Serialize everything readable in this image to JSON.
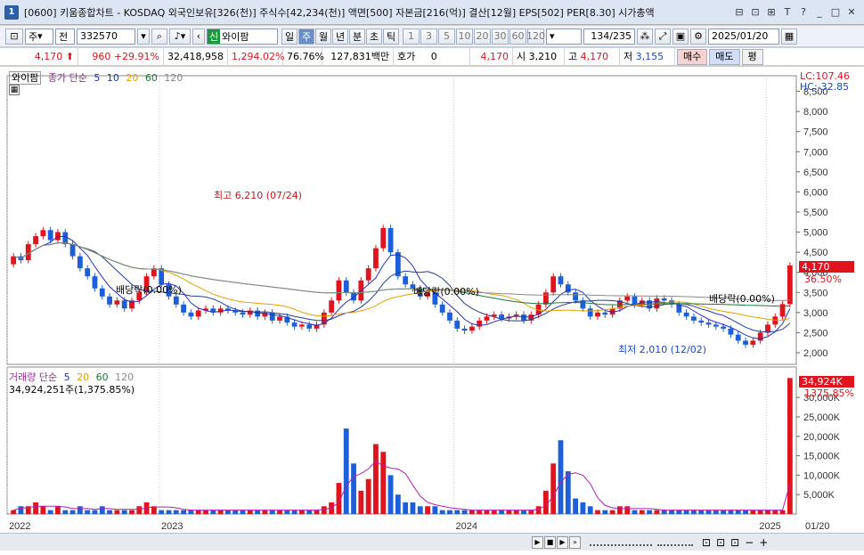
{
  "window": {
    "icon_label": "1",
    "title": "[0600] 키움종합차트 - KOSDAQ 외국인보유[326(천)] 주식수[42,234(천)] 액면[500] 자본금[216(억)] 결산[12월] EPS[502] PER[8.30] 시가총액"
  },
  "toolbar": {
    "type_select": "주",
    "type_select2": "전",
    "code": "332570",
    "market_badge": "신",
    "stock_name": "와이팜",
    "periods": [
      "일",
      "주",
      "월",
      "년",
      "분",
      "초",
      "틱"
    ],
    "selected_period": "주",
    "intervals": [
      "1",
      "3",
      "5",
      "10",
      "20",
      "30",
      "60",
      "120"
    ],
    "count": "134",
    "total": "/235",
    "date": "2025/01/20"
  },
  "quote": {
    "price": "4,170",
    "change": "960",
    "change_pct": "+29.91%",
    "volume": "32,418,958",
    "volume_pct": "1,294.02%",
    "turnover": "76.76%",
    "amount": "127,831백만",
    "hoga_label": "호가",
    "hoga_val": "0",
    "hoga_price": "4,170",
    "open_label": "시",
    "open": "3,210",
    "high_label": "고",
    "high": "4,170",
    "low_label": "저",
    "low": "3,155",
    "buy": "매수",
    "sell": "매도",
    "flat": "평"
  },
  "price_pane": {
    "name": "와이팜",
    "legend_prefix": "종가 단순",
    "ma": [
      "5",
      "10",
      "20",
      "60",
      "120"
    ],
    "lc": "LC:107.46",
    "hc": "HC:-32.85",
    "last_price": "4,170",
    "last_pct": "36.50%",
    "ann_high": "최고 6,210 (07/24)",
    "ann_low": "최저 2,010 (12/02)",
    "div1": "배당락(0.00%)",
    "div2": "배당락(0.00%)",
    "div3": "배당락(0.00%)",
    "yticks": [
      "8,500",
      "8,000",
      "7,500",
      "7,000",
      "6,500",
      "6,000",
      "5,500",
      "5,000",
      "4,500",
      "4,000",
      "3,500",
      "3,000",
      "2,500",
      "2,000"
    ]
  },
  "volume_pane": {
    "legend_prefix": "거래량 단순",
    "ma": [
      "5",
      "20",
      "60",
      "120"
    ],
    "volume_text": "34,924,251주(1,375.85%)",
    "last_vol": "34,924K",
    "last_pct": "1375.85%",
    "yticks": [
      "30,000K",
      "25,000K",
      "20,000K",
      "15,000K",
      "10,000K",
      "5,000K"
    ]
  },
  "xaxis": {
    "labels": [
      "2022",
      "2023",
      "2024",
      "2025",
      "01/20"
    ]
  },
  "colors": {
    "up": "#e0141e",
    "down": "#1c5fd8",
    "ma5": "#2030c8",
    "ma10": "#1f3f9a",
    "ma20": "#e8a000",
    "ma60": "#1a7a3a",
    "ma120": "#8a8a8a"
  },
  "chart_data": {
    "type": "candlestick",
    "ylim": [
      1800,
      8800
    ],
    "points": [
      [
        4200,
        4400
      ],
      [
        4400,
        4300
      ],
      [
        4300,
        4700
      ],
      [
        4700,
        4900
      ],
      [
        4900,
        5050
      ],
      [
        5050,
        4800
      ],
      [
        4800,
        5000
      ],
      [
        5000,
        4700
      ],
      [
        4700,
        4400
      ],
      [
        4400,
        4100
      ],
      [
        4100,
        3900
      ],
      [
        3900,
        3600
      ],
      [
        3600,
        3400
      ],
      [
        3400,
        3200
      ],
      [
        3200,
        3300
      ],
      [
        3300,
        3100
      ],
      [
        3100,
        3300
      ],
      [
        3300,
        3500
      ],
      [
        3500,
        3900
      ],
      [
        3900,
        4100
      ],
      [
        4100,
        3700
      ],
      [
        3700,
        3400
      ],
      [
        3400,
        3200
      ],
      [
        3200,
        3000
      ],
      [
        3000,
        2900
      ],
      [
        2900,
        3050
      ],
      [
        3050,
        3100
      ],
      [
        3100,
        3000
      ],
      [
        3000,
        3100
      ],
      [
        3100,
        3050
      ],
      [
        3050,
        3000
      ],
      [
        3000,
        2950
      ],
      [
        2950,
        3050
      ],
      [
        3050,
        2900
      ],
      [
        2900,
        3000
      ],
      [
        3000,
        2800
      ],
      [
        2800,
        2900
      ],
      [
        2900,
        2750
      ],
      [
        2750,
        2650
      ],
      [
        2650,
        2700
      ],
      [
        2700,
        2600
      ],
      [
        2600,
        2700
      ],
      [
        2700,
        3000
      ],
      [
        3000,
        3300
      ],
      [
        3300,
        3800
      ],
      [
        3800,
        3500
      ],
      [
        3500,
        3300
      ],
      [
        3300,
        3800
      ],
      [
        3800,
        4100
      ],
      [
        4100,
        4600
      ],
      [
        4600,
        5100
      ],
      [
        5100,
        4500
      ],
      [
        4500,
        3900
      ],
      [
        3900,
        3700
      ],
      [
        3700,
        3600
      ],
      [
        3600,
        3400
      ],
      [
        3400,
        3500
      ],
      [
        3500,
        3200
      ],
      [
        3200,
        3000
      ],
      [
        3000,
        2800
      ],
      [
        2800,
        2600
      ],
      [
        2600,
        2550
      ],
      [
        2550,
        2650
      ],
      [
        2650,
        2800
      ],
      [
        2800,
        2900
      ],
      [
        2900,
        2950
      ],
      [
        2950,
        2850
      ],
      [
        2850,
        2900
      ],
      [
        2900,
        2950
      ],
      [
        2950,
        2800
      ],
      [
        2800,
        2950
      ],
      [
        2950,
        3200
      ],
      [
        3200,
        3500
      ],
      [
        3500,
        3900
      ],
      [
        3900,
        3700
      ],
      [
        3700,
        3500
      ],
      [
        3500,
        3300
      ],
      [
        3300,
        3100
      ],
      [
        3100,
        2900
      ],
      [
        2900,
        3000
      ],
      [
        3000,
        2950
      ],
      [
        2950,
        3100
      ],
      [
        3100,
        3300
      ],
      [
        3300,
        3400
      ],
      [
        3400,
        3200
      ],
      [
        3200,
        3300
      ],
      [
        3300,
        3100
      ],
      [
        3100,
        3350
      ],
      [
        3350,
        3300
      ],
      [
        3300,
        3200
      ],
      [
        3200,
        3000
      ],
      [
        3000,
        2900
      ],
      [
        2900,
        2800
      ],
      [
        2800,
        2750
      ],
      [
        2750,
        2700
      ],
      [
        2700,
        2650
      ],
      [
        2650,
        2600
      ],
      [
        2600,
        2450
      ],
      [
        2450,
        2300
      ],
      [
        2300,
        2200
      ],
      [
        2200,
        2300
      ],
      [
        2300,
        2500
      ],
      [
        2500,
        2700
      ],
      [
        2700,
        2900
      ],
      [
        2900,
        3210
      ],
      [
        3210,
        4170
      ]
    ],
    "volume": [
      1,
      2,
      2,
      3,
      2,
      1,
      2,
      1,
      1,
      2,
      1,
      1,
      2,
      1,
      1,
      1,
      1,
      2,
      3,
      2,
      1,
      1,
      1,
      1,
      1,
      1,
      1,
      1,
      1,
      1,
      1,
      1,
      1,
      1,
      1,
      1,
      1,
      1,
      1,
      1,
      1,
      1,
      2,
      3,
      8,
      22,
      13,
      6,
      9,
      18,
      16,
      10,
      5,
      3,
      3,
      2,
      2,
      2,
      1,
      1,
      1,
      1,
      1,
      1,
      1,
      1,
      1,
      1,
      1,
      1,
      1,
      2,
      6,
      13,
      19,
      11,
      4,
      3,
      2,
      1,
      1,
      1,
      2,
      2,
      1,
      1,
      1,
      1,
      1,
      1,
      1,
      1,
      1,
      1,
      1,
      1,
      1,
      1,
      1,
      1,
      1,
      1,
      1,
      1,
      1,
      35
    ]
  }
}
